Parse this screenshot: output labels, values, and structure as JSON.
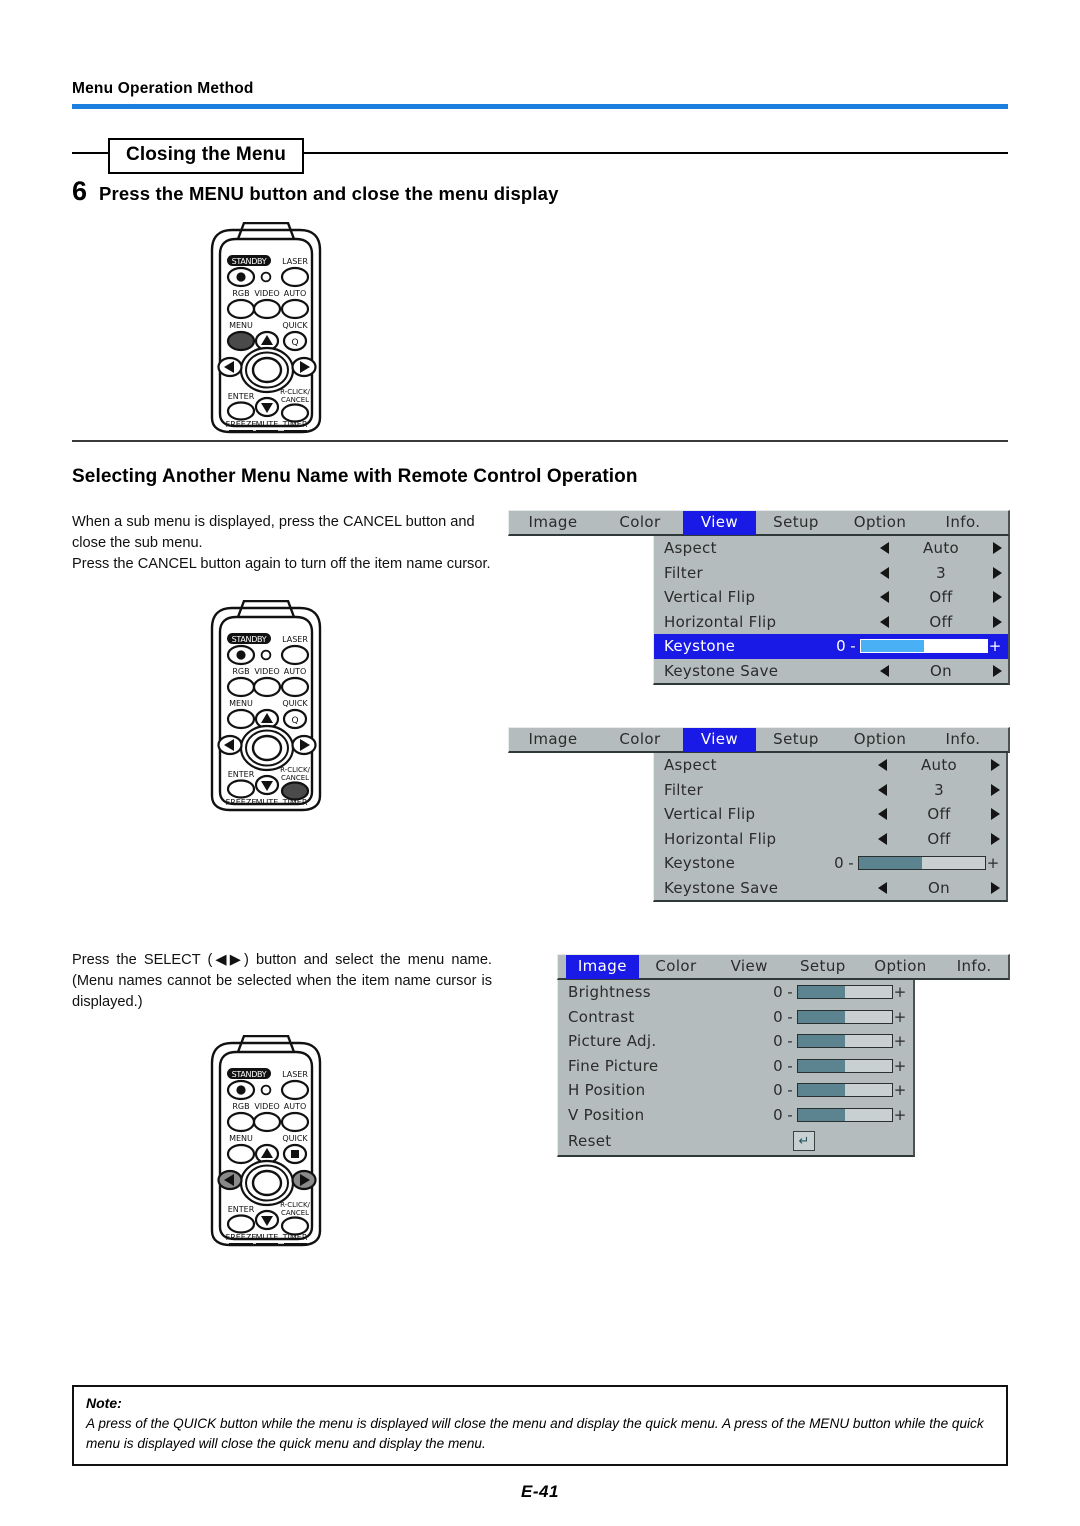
{
  "running_head": "Menu Operation Method",
  "section1": {
    "box_title": "Closing the Menu",
    "step_number": "6",
    "step_text": "Press the MENU button and close the menu display"
  },
  "section2": {
    "title": "Selecting Another Menu Name with Remote Control Operation",
    "para1": "When a sub menu is displayed, press the CANCEL button and close the sub menu.",
    "para2": "Press the CANCEL button again to turn off the item name cursor.",
    "para3": "Press the SELECT (◀▶) button and select the menu name. (Menu names cannot be selected when the item name cursor is displayed.)"
  },
  "remote": {
    "labels": {
      "standby": "STANDBY",
      "laser": "LASER",
      "rgb": "RGB",
      "video": "VIDEO",
      "auto": "AUTO",
      "menu": "MENU",
      "quick": "QUICK",
      "quick_glyph": "Q",
      "enter": "ENTER",
      "rclick_line1": "R-CLICK/",
      "rclick_line2": "CANCEL",
      "freeze": "FREEZE",
      "mute": "MUTE",
      "timer": "TIMER"
    },
    "instances": [
      {
        "name": "remote-step6",
        "highlight": "menu"
      },
      {
        "name": "remote-cancel",
        "highlight": "cancel"
      },
      {
        "name": "remote-select",
        "highlight": "left-right"
      }
    ]
  },
  "osd": {
    "tabs": [
      "Image",
      "Color",
      "View",
      "Setup",
      "Option",
      "Info."
    ],
    "panel_view_selected": {
      "active_tab": "View",
      "selected_row": "Keystone",
      "rows": [
        {
          "label": "Aspect",
          "type": "choice",
          "value": "Auto"
        },
        {
          "label": "Filter",
          "type": "choice",
          "value": "3"
        },
        {
          "label": "Vertical Flip",
          "type": "choice",
          "value": "Off"
        },
        {
          "label": "Horizontal Flip",
          "type": "choice",
          "value": "Off"
        },
        {
          "label": "Keystone",
          "type": "slider",
          "value": "0",
          "minus": "-",
          "plus": "+",
          "fill_pct": 50
        },
        {
          "label": "Keystone Save",
          "type": "choice",
          "value": "On"
        }
      ]
    },
    "panel_view_nocursor": {
      "active_tab": "View",
      "selected_row": "",
      "rows": [
        {
          "label": "Aspect",
          "type": "choice",
          "value": "Auto"
        },
        {
          "label": "Filter",
          "type": "choice",
          "value": "3"
        },
        {
          "label": "Vertical Flip",
          "type": "choice",
          "value": "Off"
        },
        {
          "label": "Horizontal Flip",
          "type": "choice",
          "value": "Off"
        },
        {
          "label": "Keystone",
          "type": "slider",
          "value": "0",
          "minus": "-",
          "plus": "+",
          "fill_pct": 50
        },
        {
          "label": "Keystone Save",
          "type": "choice",
          "value": "On"
        }
      ]
    },
    "panel_image": {
      "active_tab": "Image",
      "selected_row": "",
      "rows": [
        {
          "label": "Brightness",
          "type": "slider",
          "value": "0",
          "minus": "-",
          "plus": "+",
          "fill_pct": 50
        },
        {
          "label": "Contrast",
          "type": "slider",
          "value": "0",
          "minus": "-",
          "plus": "+",
          "fill_pct": 50
        },
        {
          "label": "Picture Adj.",
          "type": "slider",
          "value": "0",
          "minus": "-",
          "plus": "+",
          "fill_pct": 50
        },
        {
          "label": "Fine Picture",
          "type": "slider",
          "value": "0",
          "minus": "-",
          "plus": "+",
          "fill_pct": 50
        },
        {
          "label": "H Position",
          "type": "slider",
          "value": "0",
          "minus": "-",
          "plus": "+",
          "fill_pct": 50
        },
        {
          "label": "V Position",
          "type": "slider",
          "value": "0",
          "minus": "-",
          "plus": "+",
          "fill_pct": 50
        },
        {
          "label": "Reset",
          "type": "enter",
          "value": "↵"
        }
      ]
    }
  },
  "note": {
    "title": "Note:",
    "text": "A press of the QUICK button while the menu is displayed will close the menu and display the quick menu. A press of the MENU button while the quick menu is displayed will close the quick menu and display the menu."
  },
  "page_number": "E-41",
  "colors": {
    "accent_rule": "#1b7fe0",
    "osd_panel": "#b5bcbd",
    "osd_highlight": "#1a1ae6",
    "slider_fill": "#5b8390",
    "slider_fill_selected": "#49b0f5"
  }
}
